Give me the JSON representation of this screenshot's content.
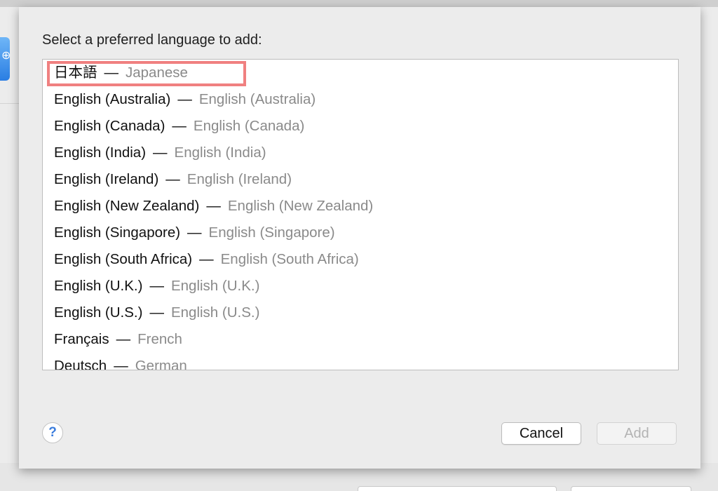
{
  "dialog": {
    "prompt": "Select a preferred language to add:",
    "languages": [
      {
        "native": "日本語",
        "separator": "—",
        "english": "Japanese"
      },
      {
        "native": "English (Australia)",
        "separator": "—",
        "english": "English (Australia)"
      },
      {
        "native": "English (Canada)",
        "separator": "—",
        "english": "English (Canada)"
      },
      {
        "native": "English (India)",
        "separator": "—",
        "english": "English (India)"
      },
      {
        "native": "English (Ireland)",
        "separator": "—",
        "english": "English (Ireland)"
      },
      {
        "native": "English (New Zealand)",
        "separator": "—",
        "english": "English (New Zealand)"
      },
      {
        "native": "English (Singapore)",
        "separator": "—",
        "english": "English (Singapore)"
      },
      {
        "native": "English (South Africa)",
        "separator": "—",
        "english": "English (South Africa)"
      },
      {
        "native": "English (U.K.)",
        "separator": "—",
        "english": "English (U.K.)"
      },
      {
        "native": "English (U.S.)",
        "separator": "—",
        "english": "English (U.S.)"
      },
      {
        "native": "Français",
        "separator": "—",
        "english": "French"
      },
      {
        "native": "Deutsch",
        "separator": "—",
        "english": "German"
      }
    ],
    "help_label": "?",
    "cancel_label": "Cancel",
    "add_label": "Add"
  },
  "colors": {
    "highlight": "#f08080",
    "secondary_text": "#8a8a8a",
    "help_accent": "#3b7ddd"
  },
  "icons": {
    "background_app": "globe-icon"
  }
}
